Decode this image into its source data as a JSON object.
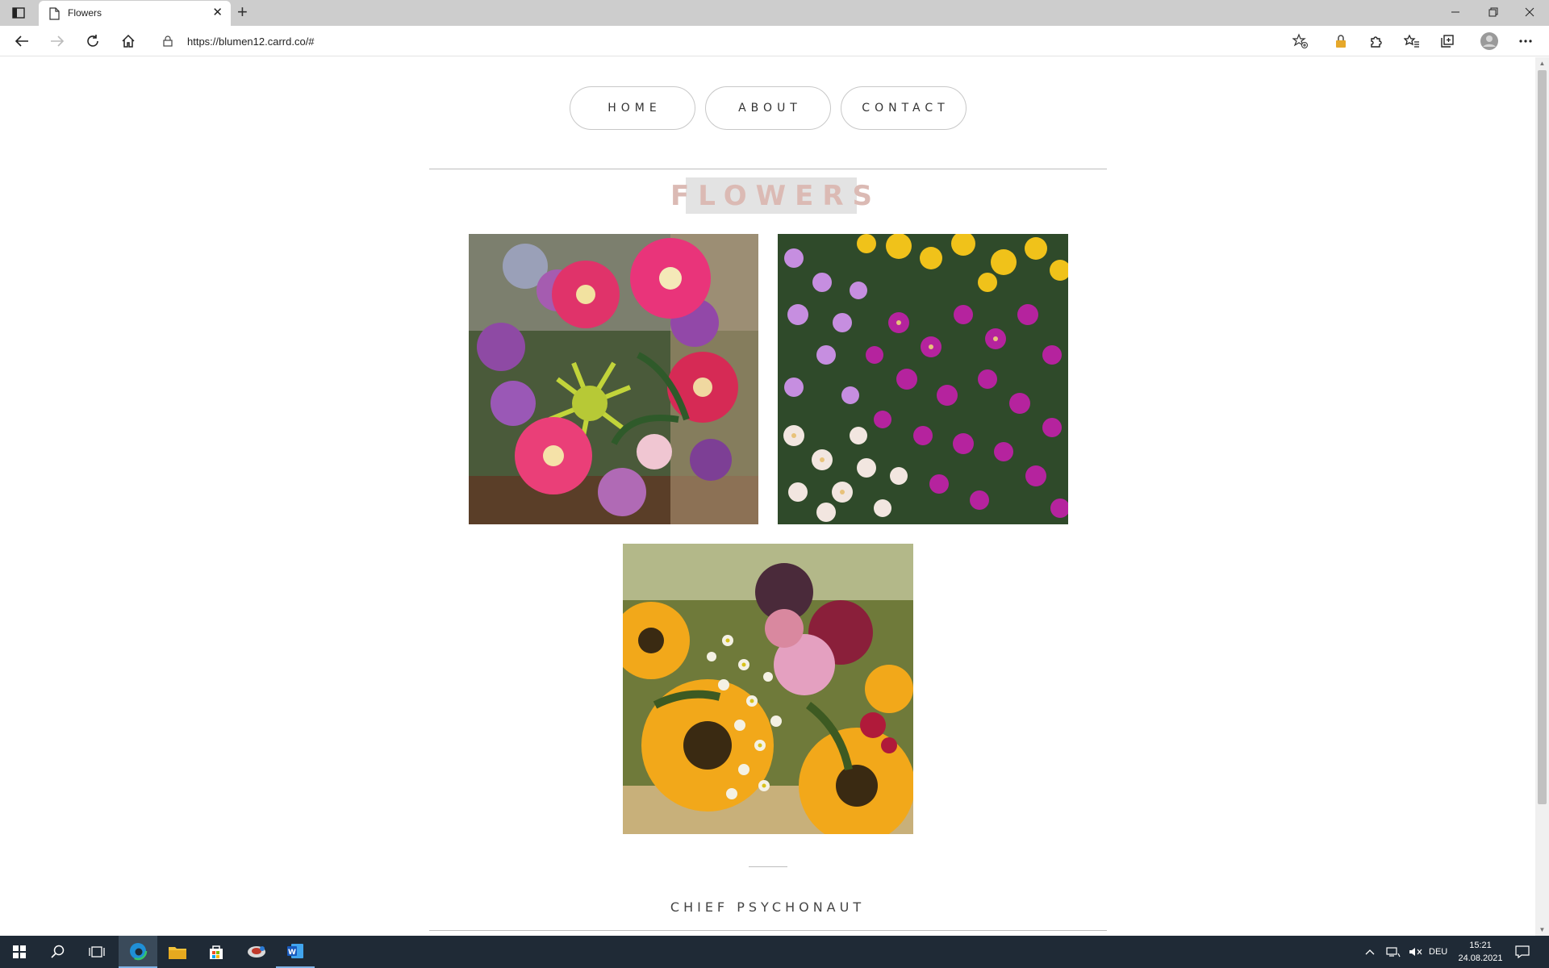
{
  "browser": {
    "tab_title": "Flowers",
    "url": "https://blumen12.carrd.co/#",
    "new_tab_symbol": "+",
    "tab_close_symbol": "✕"
  },
  "nav": {
    "items": [
      {
        "label": "HOME"
      },
      {
        "label": "ABOUT"
      },
      {
        "label": "CONTACT"
      }
    ]
  },
  "page": {
    "title": "FLOWERS",
    "footer_name": "CHIEF PSYCHONAUT",
    "title_color": "#dbbab4",
    "title_bg": "#e3e3e3"
  },
  "gallery": {
    "images": [
      {
        "name": "flower-bouquet-pink-gerbera-image"
      },
      {
        "name": "purple-white-asters-field-image"
      },
      {
        "name": "sunflower-bouquet-image"
      }
    ]
  },
  "taskbar": {
    "language": "DEU",
    "time": "15:21",
    "date": "24.08.2021"
  }
}
